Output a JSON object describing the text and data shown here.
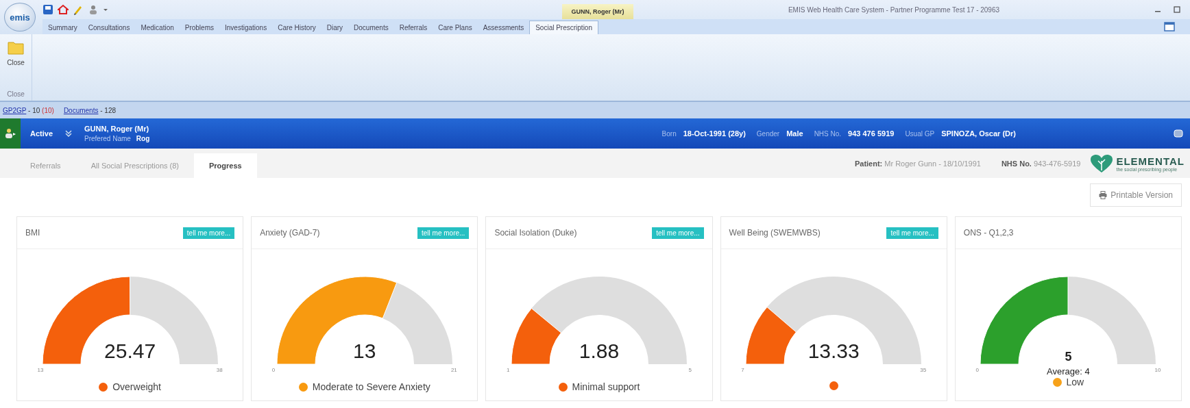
{
  "window": {
    "logo": "emis",
    "title": "EMIS Web Health Care System - Partner Programme Test 17 - 20963",
    "context_tab": "GUNN, Roger (Mr)"
  },
  "ribbon_tabs": [
    {
      "label": "Summary",
      "selected": false
    },
    {
      "label": "Consultations",
      "selected": false
    },
    {
      "label": "Medication",
      "selected": false
    },
    {
      "label": "Problems",
      "selected": false
    },
    {
      "label": "Investigations",
      "selected": false
    },
    {
      "label": "Care History",
      "selected": false
    },
    {
      "label": "Diary",
      "selected": false
    },
    {
      "label": "Documents",
      "selected": false
    },
    {
      "label": "Referrals",
      "selected": false
    },
    {
      "label": "Care Plans",
      "selected": false
    },
    {
      "label": "Assessments",
      "selected": false
    },
    {
      "label": "Social Prescription",
      "selected": true
    }
  ],
  "ribbon": {
    "button": "Close",
    "group_label": "Close"
  },
  "links": [
    {
      "link": "GP2GP",
      "count": "- 10",
      "alert": "(10)"
    },
    {
      "link": "Documents",
      "count": "- 128"
    }
  ],
  "patient_banner": {
    "status": "Active",
    "name": "GUNN, Roger (Mr)",
    "preferred_name_label": "Prefered Name",
    "preferred_name": "Rog",
    "fields": [
      {
        "label": "Born",
        "value": "18-Oct-1991 (28y)"
      },
      {
        "label": "Gender",
        "value": "Male"
      },
      {
        "label": "NHS No.",
        "value": "943 476 5919"
      },
      {
        "label": "Usual GP",
        "value": "SPINOZA, Oscar (Dr)"
      }
    ]
  },
  "subtabs": [
    {
      "label": "Referrals",
      "selected": false
    },
    {
      "label": "All Social Prescriptions (8)",
      "selected": false
    },
    {
      "label": "Progress",
      "selected": true
    }
  ],
  "patient_info": [
    {
      "label": "Patient:",
      "value": "Mr Roger Gunn - 18/10/1991"
    },
    {
      "label": "NHS No.",
      "value": "943-476-5919"
    }
  ],
  "brand": {
    "name": "ELEMENTAL",
    "tagline": "the social prescribing people"
  },
  "printable_button": "Printable Version",
  "gauges": [
    {
      "title": "BMI",
      "button": "tell me more...",
      "value": "25.47",
      "min": "13",
      "max": "38",
      "color": "#f4600c",
      "status": {
        "label": "Overweight",
        "color": "#f4600c"
      }
    },
    {
      "title": "Anxiety (GAD-7)",
      "button": "tell me more...",
      "value": "13",
      "min": "0",
      "max": "21",
      "color": "#f89a10",
      "status": {
        "label": "Moderate to Severe Anxiety",
        "color": "#f89a10"
      }
    },
    {
      "title": "Social Isolation (Duke)",
      "button": "tell me more...",
      "value": "1.88",
      "min": "1",
      "max": "5",
      "color": "#f4600c",
      "status": {
        "label": "Minimal support",
        "color": "#f4600c"
      }
    },
    {
      "title": "Well Being (SWEMWBS)",
      "button": "tell me more...",
      "value": "13.33",
      "min": "7",
      "max": "35",
      "color": "#f4600c",
      "status": {
        "color": "#f4600c"
      }
    },
    {
      "title": "ONS - Q1,2,3",
      "value": "5",
      "min": "0",
      "max": "10",
      "color": "#2ca02c",
      "average": "Average: 4",
      "status": {
        "label": "Low",
        "color": "#f7a21a"
      }
    }
  ]
}
